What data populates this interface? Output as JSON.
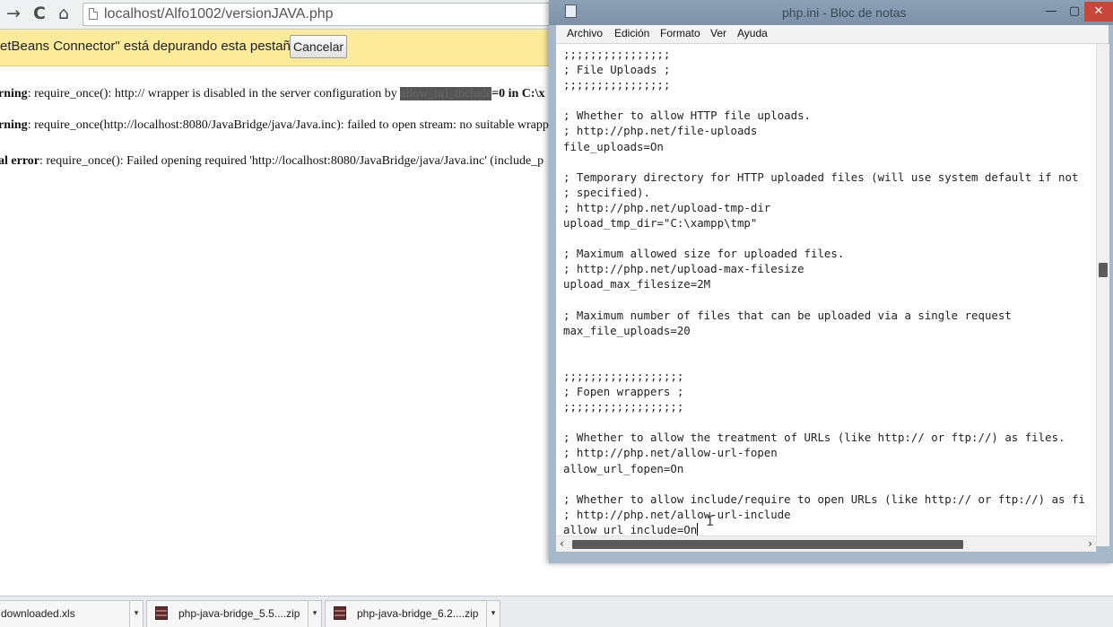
{
  "browser": {
    "url": "localhost/Alfo1002/versionJAVA.php",
    "nav": {
      "forward_icon": "→",
      "reload_icon": "C",
      "home_icon": "⌂"
    },
    "infobar": {
      "text": "etBeans Connector\" está depurando esta pestaña.",
      "cancel_label": "Cancelar"
    },
    "messages": [
      {
        "label": "rning",
        "text": ": require_once(): http:// wrapper is disabled in the server configuration by ",
        "highlight": "allow_url_include",
        "tail": "=0 in C:\\x"
      },
      {
        "label": "rning",
        "text": ": require_once(http://localhost:8080/JavaBridge/java/Java.inc): failed to open stream: no suitable wrapp",
        "highlight": "",
        "tail": ""
      },
      {
        "label": "al error",
        "text": ": require_once(): Failed opening required 'http://localhost:8080/JavaBridge/java/Java.inc' (include_p",
        "highlight": "",
        "tail": ""
      }
    ]
  },
  "notepad": {
    "title": "php.ini - Bloc de notas",
    "window_buttons": {
      "minimize": "—",
      "maximize": "▢",
      "close": "✕"
    },
    "menu": [
      "Archivo",
      "Edición",
      "Formato",
      "Ver",
      "Ayuda"
    ],
    "content_lines": [
      ";;;;;;;;;;;;;;;;",
      "; File Uploads ;",
      ";;;;;;;;;;;;;;;;",
      "",
      "; Whether to allow HTTP file uploads.",
      "; http://php.net/file-uploads",
      "file_uploads=On",
      "",
      "; Temporary directory for HTTP uploaded files (will use system default if not",
      "; specified).",
      "; http://php.net/upload-tmp-dir",
      "upload_tmp_dir=\"C:\\xampp\\tmp\"",
      "",
      "; Maximum allowed size for uploaded files.",
      "; http://php.net/upload-max-filesize",
      "upload_max_filesize=2M",
      "",
      "; Maximum number of files that can be uploaded via a single request",
      "max_file_uploads=20",
      "",
      "",
      ";;;;;;;;;;;;;;;;;;",
      "; Fopen wrappers ;",
      ";;;;;;;;;;;;;;;;;;",
      "",
      "; Whether to allow the treatment of URLs (like http:// or ftp://) as files.",
      "; http://php.net/allow-url-fopen",
      "allow_url_fopen=On",
      "",
      "; Whether to allow include/require to open URLs (like http:// or ftp://) as fi",
      "; http://php.net/allow-url-include"
    ],
    "last_line": "allow_url_include=On"
  },
  "downloads": [
    {
      "name": "downloaded.xls"
    },
    {
      "name": "php-java-bridge_5.5....zip"
    },
    {
      "name": "php-java-bridge_6.2....zip"
    }
  ]
}
